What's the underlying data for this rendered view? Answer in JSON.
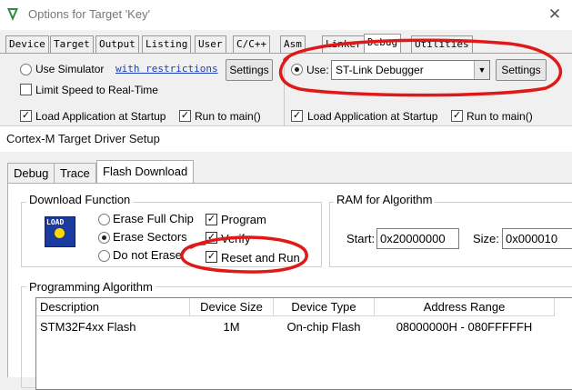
{
  "top_window": {
    "title": "Options for Target 'Key'",
    "tabs": [
      "Device",
      "Target",
      "Output",
      "Listing",
      "User",
      "C/C++",
      "Asm",
      "Linker",
      "Debug",
      "Utilities"
    ],
    "active_tab": "Debug",
    "left": {
      "use_simulator": "Use Simulator",
      "restrictions_link": "with restrictions",
      "settings": "Settings",
      "limit_speed": "Limit Speed to Real-Time",
      "load_app": "Load Application at Startup",
      "run_to_main": "Run to main()"
    },
    "right": {
      "use_label": "Use:",
      "debugger_value": "ST-Link Debugger",
      "settings": "Settings",
      "load_app": "Load Application at Startup",
      "run_to_main": "Run to main()"
    }
  },
  "driver_window": {
    "title": "Cortex-M Target Driver Setup",
    "tabs": [
      "Debug",
      "Trace",
      "Flash Download"
    ],
    "active_tab": "Flash Download",
    "download_function": {
      "title": "Download Function",
      "icon_text": "LOAD",
      "erase_full": "Erase Full Chip",
      "erase_sectors": "Erase Sectors",
      "no_erase": "Do not Erase",
      "selected": "Erase Sectors",
      "program": "Program",
      "verify": "Verify",
      "reset_run": "Reset and Run"
    },
    "ram": {
      "title": "RAM for Algorithm",
      "start_label": "Start:",
      "start_value": "0x20000000",
      "size_label": "Size:",
      "size_value": "0x000010"
    },
    "algorithm": {
      "title": "Programming Algorithm",
      "columns": [
        "Description",
        "Device Size",
        "Device Type",
        "Address Range"
      ],
      "rows": [
        [
          "STM32F4xx Flash",
          "1M",
          "On-chip Flash",
          "08000000H - 080FFFFFH"
        ]
      ]
    }
  },
  "colors": {
    "annotation": "#e01818",
    "link": "#1a3fbf"
  }
}
